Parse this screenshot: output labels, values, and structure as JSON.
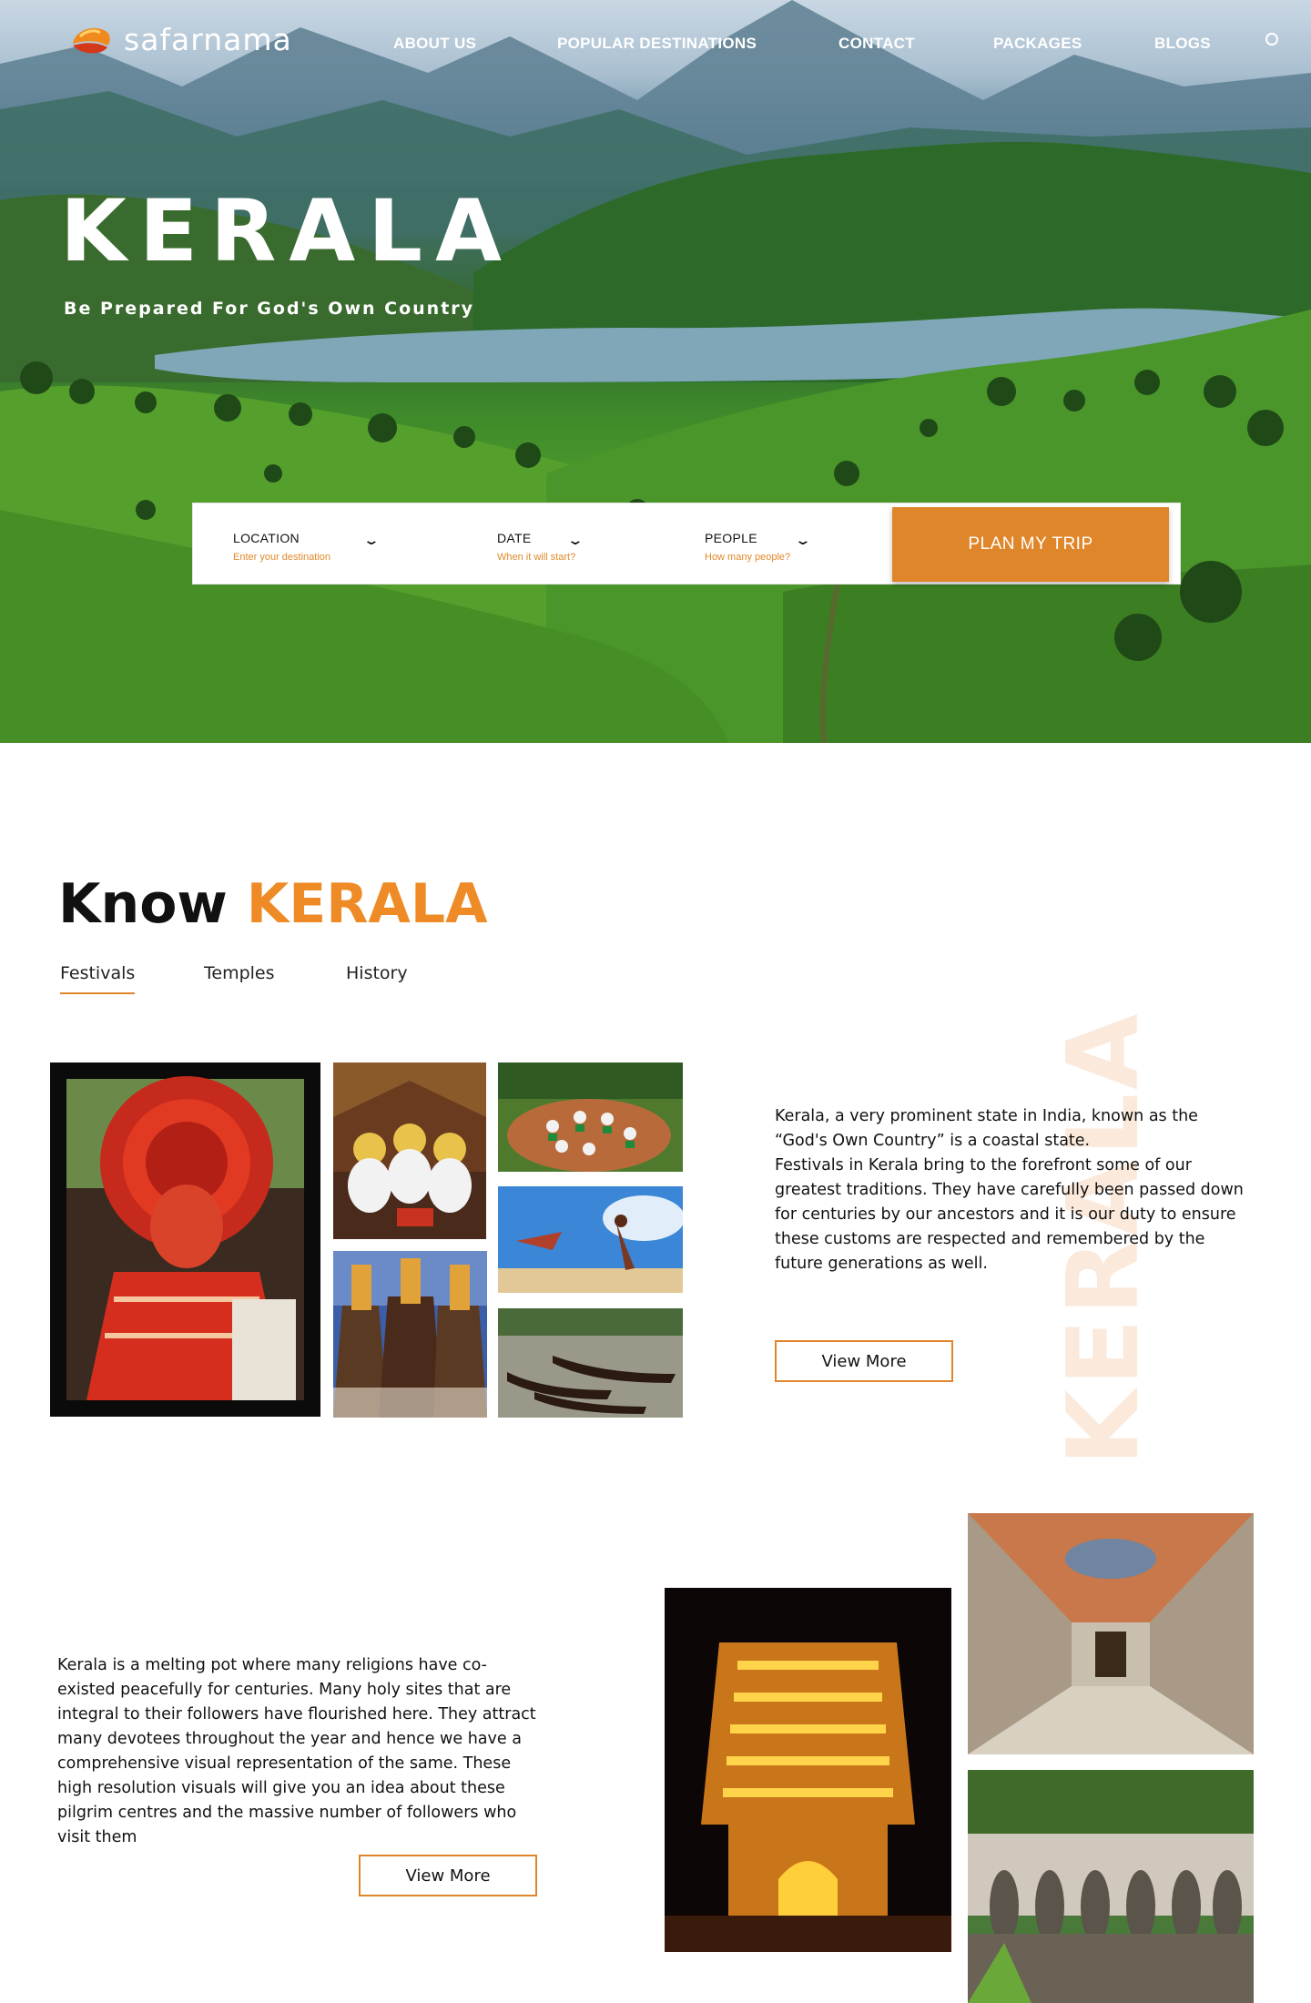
{
  "brand": {
    "name": "safarnama",
    "colors": {
      "accent": "#e0862a",
      "title_accent": "#ee8b26",
      "watermark": "#fbeadb"
    }
  },
  "nav": {
    "items": [
      {
        "label": "ABOUT US"
      },
      {
        "label": "POPULAR DESTINATIONS"
      },
      {
        "label": "CONTACT"
      },
      {
        "label": "PACKAGES"
      },
      {
        "label": "BLOGS"
      }
    ],
    "search_icon": "search-icon"
  },
  "hero": {
    "title": "KERALA",
    "subtitle": "Be Prepared For God's Own Country"
  },
  "search": {
    "location": {
      "label": "LOCATION",
      "hint": "Enter your destination"
    },
    "date": {
      "label": "DATE",
      "hint": "When it will start?"
    },
    "people": {
      "label": "PEOPLE",
      "hint": "How many people?"
    },
    "button": "PLAN MY TRIP"
  },
  "know": {
    "title_word1": "Know",
    "title_word2": "KERALA",
    "tabs": [
      {
        "label": "Festivals",
        "active": true
      },
      {
        "label": "Temples",
        "active": false
      },
      {
        "label": "History",
        "active": false
      }
    ],
    "watermark": "KERALA"
  },
  "festivals": {
    "paragraph1": "Kerala, a very prominent state in India, known as the “God's Own Country” is a coastal state.",
    "paragraph2": "Festivals in Kerala bring to the forefront some of our greatest traditions. They have carefully been passed down for centuries by our ancestors and it is our duty to ensure these customs are respected and remembered by the future generations as well.",
    "button": "View More"
  },
  "temples": {
    "paragraph": "Kerala is a melting pot where many religions have co-existed peacefully for centuries. Many holy sites that are integral to their followers have flourished here. They attract many devotees throughout the year and hence we have a comprehensive visual representation of the same. These high resolution visuals will give you an idea about these pilgrim centres and the massive number of followers who visit them",
    "button": "View More"
  }
}
